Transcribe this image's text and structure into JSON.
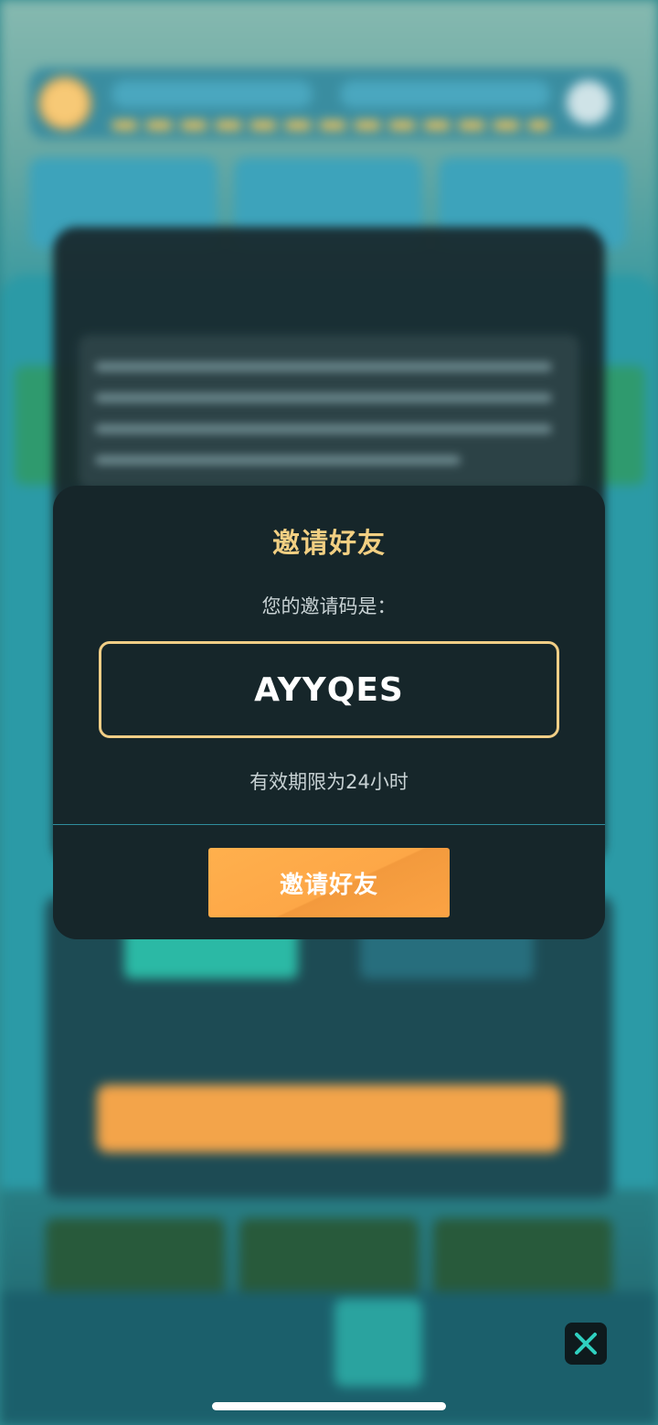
{
  "dialog": {
    "title": "邀请好友",
    "code_label": "您的邀请码是：",
    "invite_code": "AYYQES",
    "validity_note": "有效期限为24小时",
    "invite_button": "邀请好友"
  },
  "colors": {
    "title_gold": "#f2cf82",
    "code_border": "#f1ce86",
    "button_orange": "#fda747",
    "modal_bg": "#16262a",
    "divider": "#2f8d9e"
  },
  "icons": {
    "close": "close-x-icon"
  }
}
